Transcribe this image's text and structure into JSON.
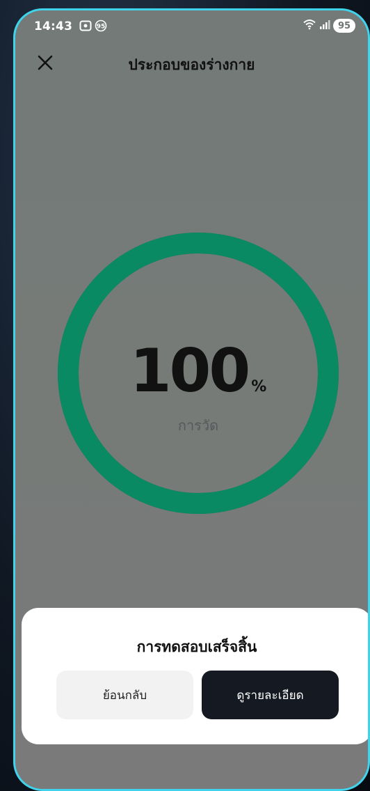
{
  "status_bar": {
    "time": "14:43",
    "notification_badge": "95",
    "battery": "95"
  },
  "header": {
    "title": "ประกอบของร่างกาย"
  },
  "gauge": {
    "value": "100",
    "unit": "%",
    "label": "การวัด",
    "progress_fraction": 1.0,
    "ring_color": "#0a8a62"
  },
  "dialog": {
    "title": "การทดสอบเสร็จสิ้น",
    "back_label": "ย้อนกลับ",
    "details_label": "ดูรายละเอียด"
  },
  "colors": {
    "overlay": "#767b78",
    "border_accent": "#3fd4ec",
    "primary_button": "#151922"
  },
  "icons": [
    "screen-record-icon",
    "notification-badge-icon",
    "wifi-icon",
    "signal-icon",
    "battery-icon",
    "close-icon"
  ]
}
